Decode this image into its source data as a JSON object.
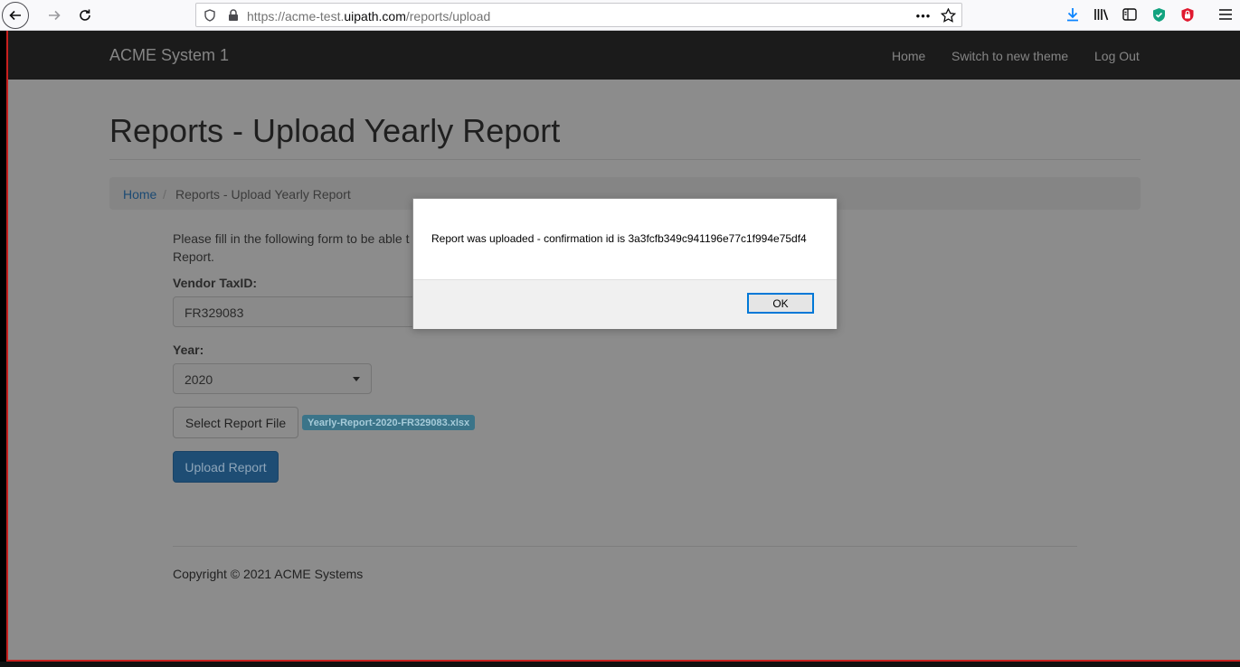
{
  "browser": {
    "url_prefix": "https://acme-test.",
    "url_domain": "uipath.com",
    "url_path": "/reports/upload",
    "page_actions_icon": "•••"
  },
  "navbar": {
    "brand": "ACME System 1",
    "links": [
      "Home",
      "Switch to new theme",
      "Log Out"
    ]
  },
  "page": {
    "title": "Reports - Upload Yearly Report",
    "breadcrumb": {
      "home": "Home",
      "separator": "/",
      "current": "Reports - Upload Yearly Report"
    },
    "intro_line1": "Please fill in the following form to be able t",
    "intro_line2": "Report."
  },
  "form": {
    "vendor_label": "Vendor TaxID:",
    "vendor_value": "FR329083",
    "year_label": "Year:",
    "year_value": "2020",
    "select_file_label": "Select Report File",
    "file_name": "Yearly-Report-2020-FR329083.xlsx",
    "upload_label": "Upload Report"
  },
  "footer": {
    "copyright": "Copyright © 2021 ACME Systems"
  },
  "dialog": {
    "message": "Report was uploaded - confirmation id is 3a3fcfb349c941196e77c1f994e75df4",
    "ok_label": "OK"
  },
  "colors": {
    "navbar_bg": "#1b1b1b",
    "page_overlay": "#8c8c8c",
    "primary_button": "#1e4d74",
    "badge": "#3b7489",
    "dialog_focus": "#0078d7",
    "window_border": "#c8201e"
  }
}
